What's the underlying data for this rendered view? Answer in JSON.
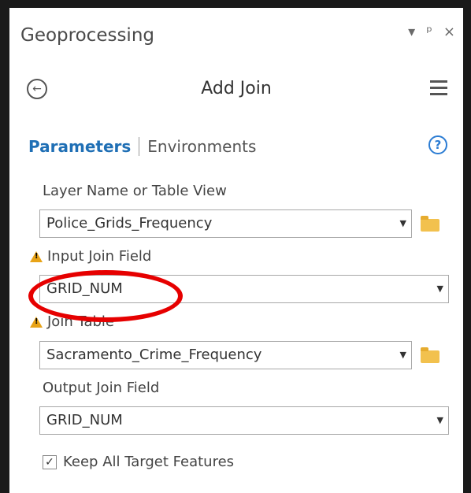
{
  "pane": {
    "title": "Geoprocessing",
    "controls": {
      "dropdown": "▾",
      "pin": "ᵖ",
      "close": "×"
    }
  },
  "tool": {
    "title": "Add Join"
  },
  "tabs": {
    "parameters": "Parameters",
    "environments": "Environments"
  },
  "help": "?",
  "fields": {
    "layer": {
      "label": "Layer Name or Table View",
      "value": "Police_Grids_Frequency"
    },
    "input_join": {
      "label": "Input Join Field",
      "value": "GRID_NUM"
    },
    "join_table": {
      "label": "Join Table",
      "value": "Sacramento_Crime_Frequency"
    },
    "output_join": {
      "label": "Output Join Field",
      "value": "GRID_NUM"
    }
  },
  "keep_all": {
    "label": "Keep All Target Features",
    "checked": "✓"
  },
  "colors": {
    "accent": "#1f6fb5",
    "highlight": "#e60000",
    "warning": "#e8a317",
    "folder": "#f2c14e"
  }
}
